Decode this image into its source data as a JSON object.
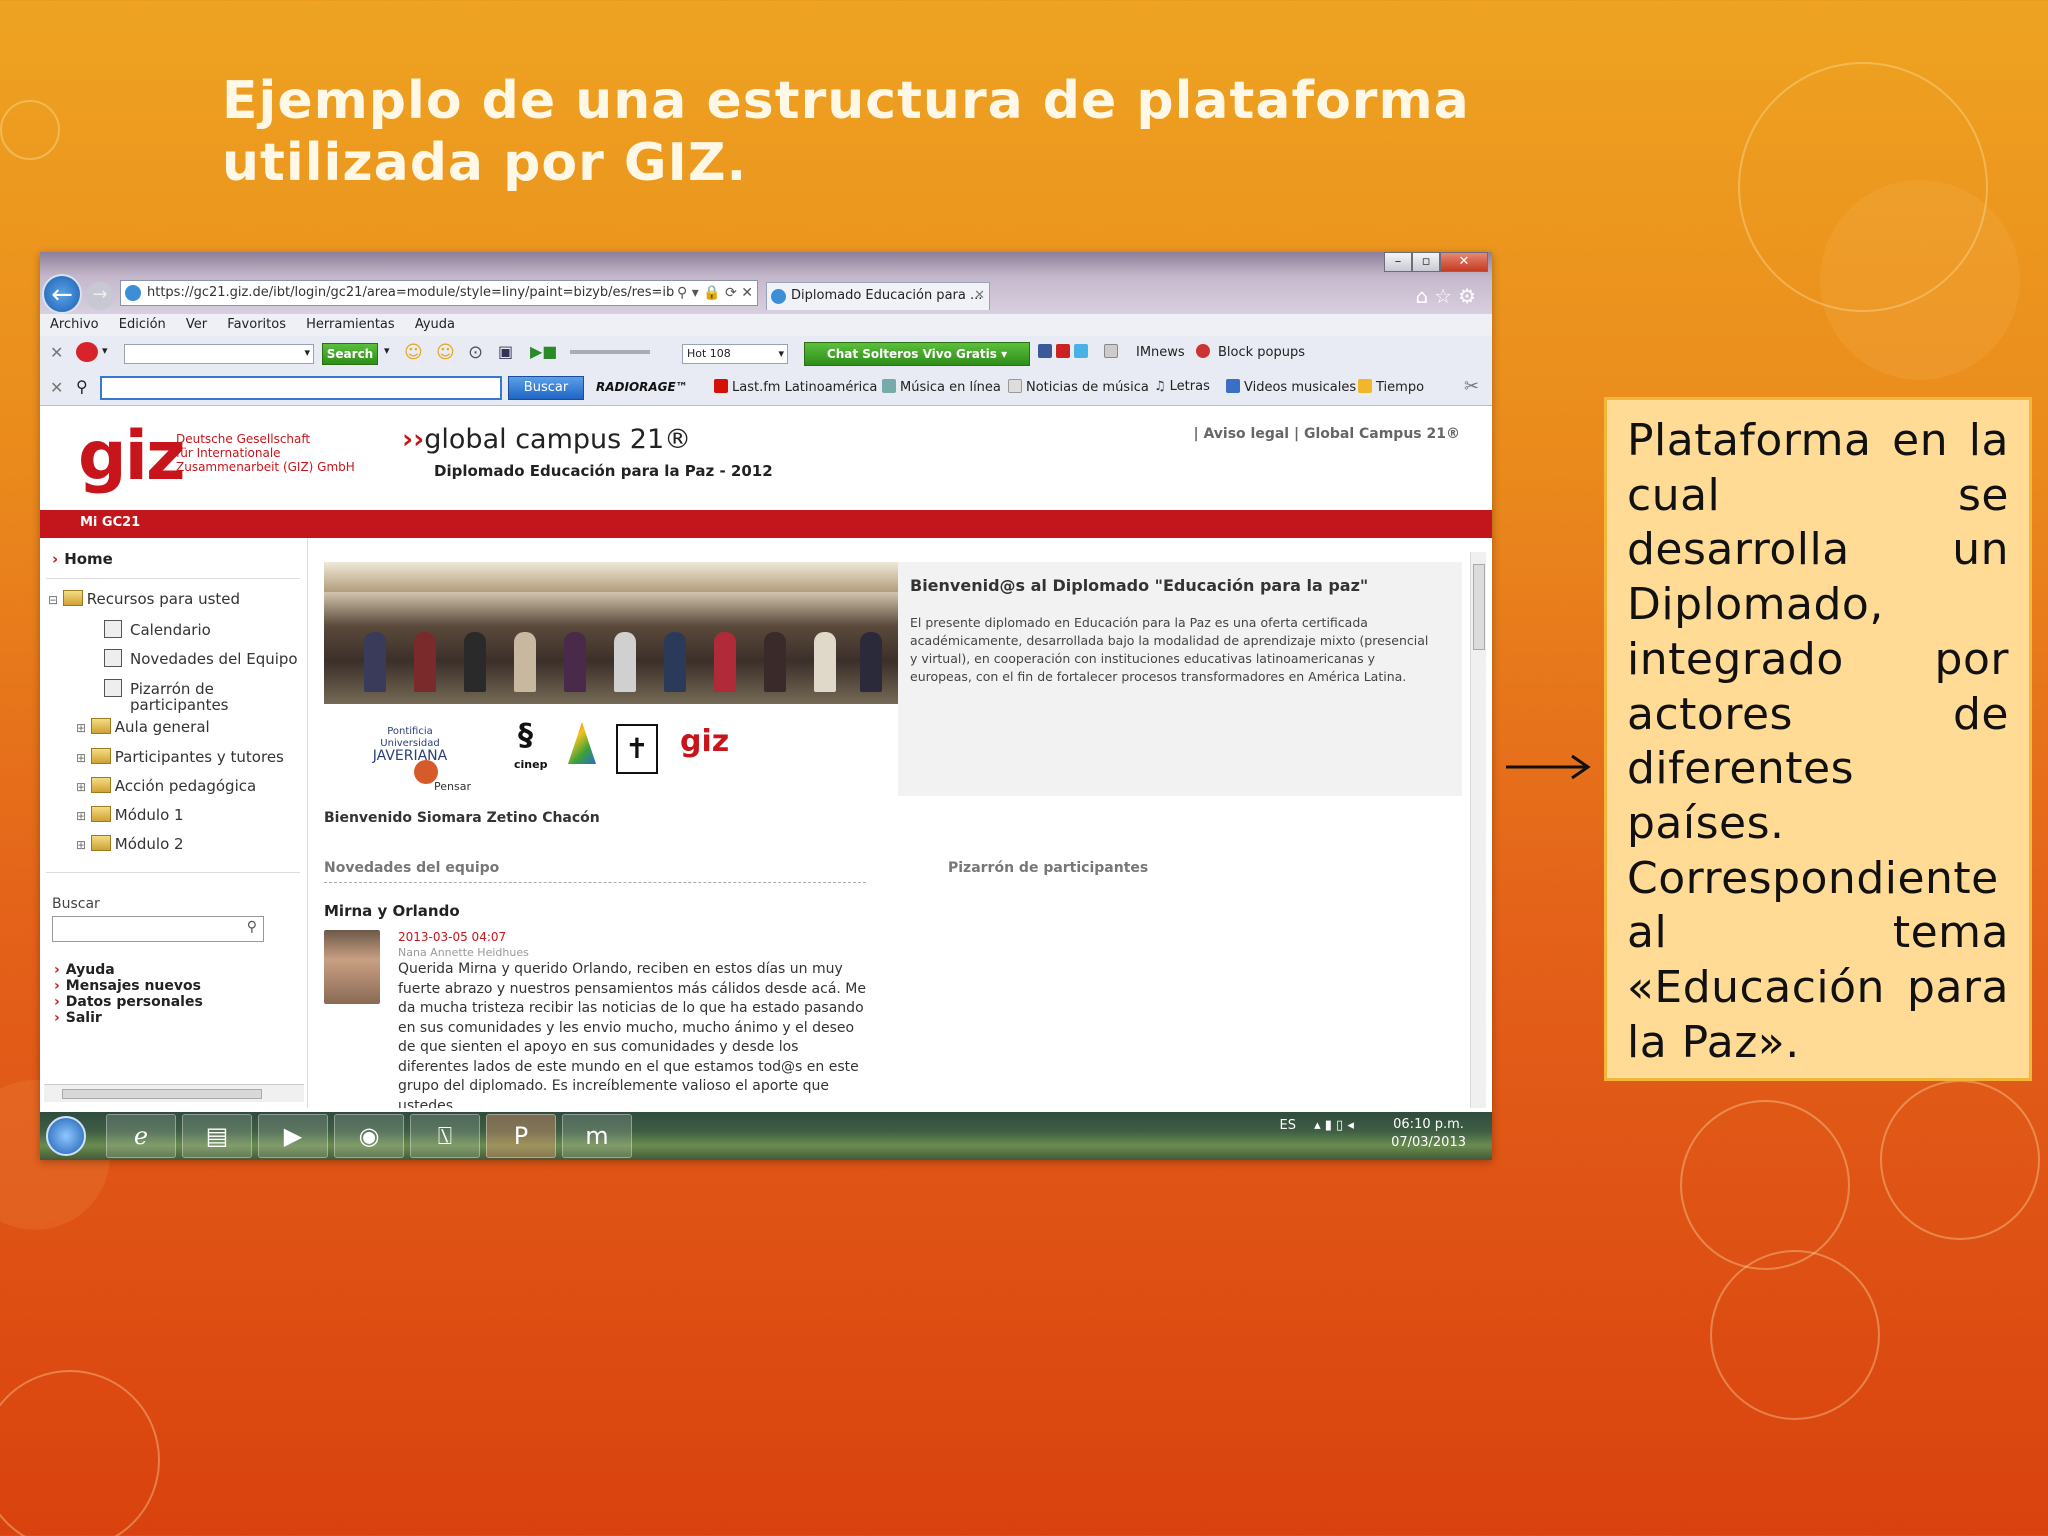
{
  "slide": {
    "title": "Ejemplo de una estructura de plataforma utilizada por GIZ.",
    "note": "Plataforma en la cual se desarrolla un Diplomado, integrado por actores de diferentes países. Correspondiente al tema «Educación para la Paz»."
  },
  "browser": {
    "address": "https://gc21.giz.de/ibt/login/gc21/area=module/style=liny/paint=bizyb/es/res=ib",
    "tab_title": "Diplomado Educación para ...",
    "menu": [
      "Archivo",
      "Edición",
      "Ver",
      "Favoritos",
      "Herramientas",
      "Ayuda"
    ],
    "toolbar1": {
      "search_button": "Search",
      "radio_select": "Hot 108",
      "chat_button": "Chat Solteros Vivo Gratis ▾",
      "imnews": "IMnews",
      "block_popups": "Block popups"
    },
    "toolbar2": {
      "buscar_button": "Buscar",
      "radiorage": "RADIORAGE™",
      "links": [
        "Last.fm Latinoamérica",
        "Música en línea",
        "Noticias de música",
        "Letras",
        "Videos musicales",
        "Tiempo"
      ]
    }
  },
  "site": {
    "logo": "giz",
    "org_name": "Deutsche Gesellschaft\nfür Internationale\nZusammenarbeit (GIZ) GmbH",
    "campus_title": "global campus 21®",
    "campus_sub": "Diplomado Educación para la Paz - 2012",
    "top_links": "| Aviso legal | Global Campus 21®",
    "redbar_label": "Mi GC21",
    "sidebar": {
      "home": "Home",
      "tree": {
        "recursos": "Recursos para usted",
        "calendario": "Calendario",
        "novedades": "Novedades del Equipo",
        "pizarron_1": "Pizarrón de",
        "pizarron_2": "participantes",
        "aula": "Aula general",
        "participantes": "Participantes y tutores",
        "accion": "Acción pedagógica",
        "modulo1": "Módulo 1",
        "modulo2": "Módulo 2"
      },
      "search_label": "Buscar",
      "links": {
        "ayuda": "Ayuda",
        "mensajes": "Mensajes nuevos",
        "datos": "Datos personales",
        "salir": "Salir"
      }
    },
    "welcome": {
      "title": "Bienvenid@s al Diplomado \"Educación para la paz\"",
      "text": "El presente diplomado en Educación para la Paz es una oferta certificada académicamente, desarrollada bajo la modalidad de aprendizaje mixto (presencial y virtual), en cooperación con instituciones educativas latinoamericanas y europeas, con el fin de fortalecer procesos transformadores en América Latina."
    },
    "logos": {
      "javeriana_1": "Pontificia Universidad",
      "javeriana_2": "JAVERIANA",
      "pensar": "Pensar",
      "cinep": "cinep",
      "giz": "giz"
    },
    "greeting": "Bienvenido Siomara Zetino Chacón",
    "novedades_heading": "Novedades del equipo",
    "pizarron_heading": "Pizarrón de participantes",
    "post": {
      "author": "Mirna y Orlando",
      "date": "2013-03-05 04:07",
      "by": "Nana Annette Heidhues",
      "body": "Querida Mirna y querido Orlando, reciben en estos días un muy fuerte abrazo y nuestros pensamientos más cálidos desde acá. Me da mucha tristeza recibir las noticias de lo que ha estado pasando en sus comunidades y les envio mucho, mucho ánimo y el deseo de que sienten el apoyo en sus comunidades y desde los diferentes lados de este mundo en el que estamos tod@s en este grupo del diplomado. Es increíblemente valioso el aporte que ustedes"
    }
  },
  "taskbar": {
    "lang": "ES",
    "time": "06:10 p.m.",
    "date": "07/03/2013"
  },
  "colors": {
    "giz_red": "#c8151b",
    "slide_orange": "#ea8a1c",
    "note_fill": "#ffdb96"
  }
}
